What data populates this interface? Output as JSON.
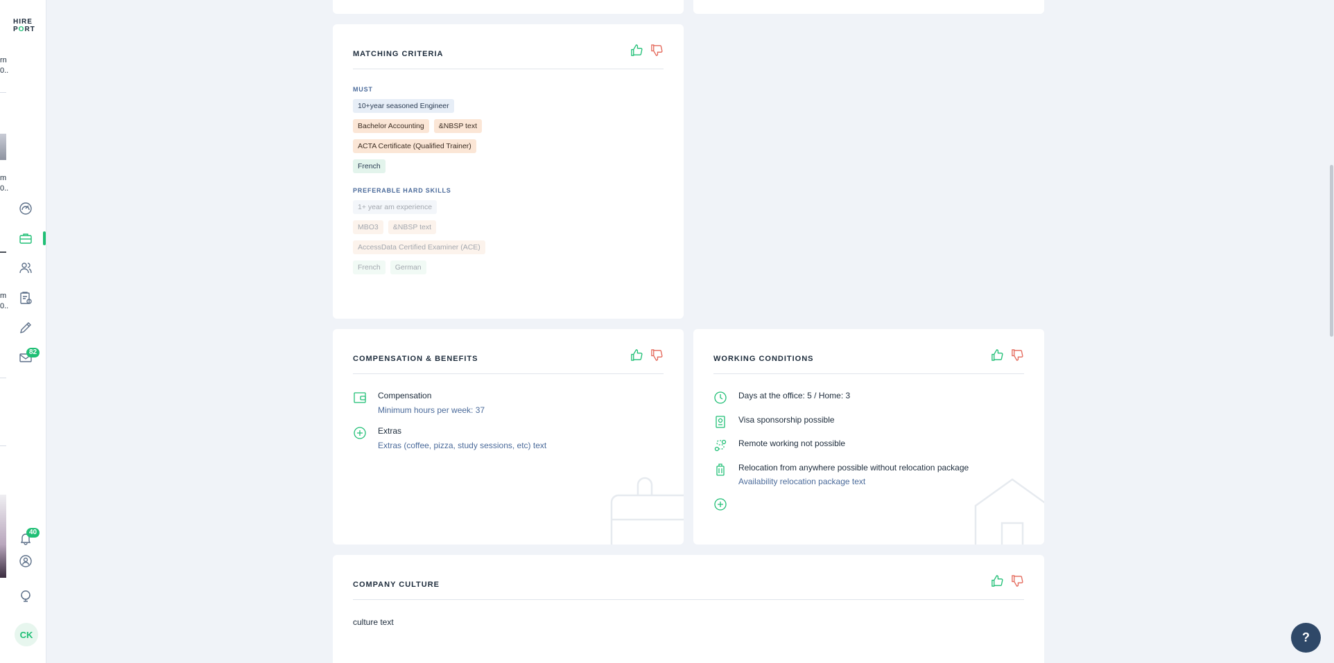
{
  "sidebar": {
    "logo_line1": "HIRE",
    "logo_line2_a": "P",
    "logo_line2_o": "O",
    "logo_line2_b": "RT",
    "peeks": [
      "rn",
      "0..",
      "m",
      "0..",
      "m",
      "0.."
    ],
    "badges": {
      "messages": "82",
      "notifications": "40"
    },
    "avatar_initials": "CK"
  },
  "matching": {
    "title": "MATCHING CRITERIA",
    "must_label": "MUST",
    "must_rows": [
      [
        {
          "text": "10+year seasoned Engineer",
          "color": "blue"
        }
      ],
      [
        {
          "text": "Bachelor Accounting",
          "color": "orange"
        },
        {
          "text": "&NBSP text",
          "color": "orange"
        }
      ],
      [
        {
          "text": "ACTA Certificate (Qualified Trainer)",
          "color": "orange"
        }
      ],
      [
        {
          "text": "French",
          "color": "green"
        }
      ]
    ],
    "pref_label": "PREFERABLE HARD SKILLS",
    "pref_rows": [
      [
        {
          "text": "1+ year am experience",
          "color": "faded-b"
        }
      ],
      [
        {
          "text": "MBO3",
          "color": "faded-o"
        },
        {
          "text": "&NBSP text",
          "color": "faded-o"
        }
      ],
      [
        {
          "text": "AccessData Certified Examiner (ACE)",
          "color": "faded-o"
        }
      ],
      [
        {
          "text": "French",
          "color": "faded-g"
        },
        {
          "text": "German",
          "color": "faded-g"
        }
      ]
    ]
  },
  "compensation": {
    "title": "COMPENSATION & BENEFITS",
    "items": [
      {
        "title": "Compensation",
        "sub": "Minimum hours per week: 37"
      },
      {
        "title": "Extras",
        "sub": "Extras (coffee, pizza, study sessions, etc) text"
      }
    ]
  },
  "working": {
    "title": "WORKING CONDITIONS",
    "items": [
      {
        "title": "Days at the office: 5 / Home: 3",
        "sub": ""
      },
      {
        "title": "Visa sponsorship possible",
        "sub": ""
      },
      {
        "title": "Remote working not possible",
        "sub": ""
      },
      {
        "title": "Relocation from anywhere possible without relocation package",
        "sub": "Availability relocation package text"
      }
    ]
  },
  "culture": {
    "title": "COMPANY CULTURE",
    "text": "culture text"
  },
  "help_label": "?",
  "colors": {
    "accent": "#1fbf75",
    "dislike": "#e4685a",
    "help": "#2f4868"
  }
}
